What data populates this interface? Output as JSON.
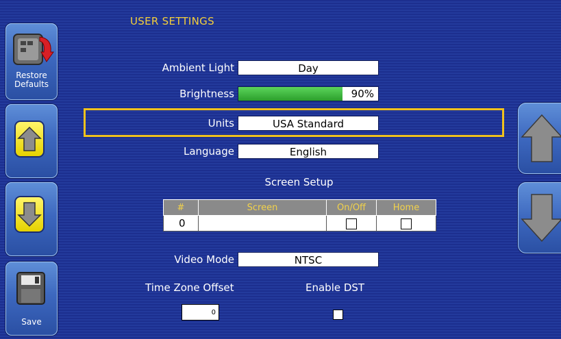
{
  "header": {
    "title": "USER SETTINGS"
  },
  "left_buttons": {
    "restore_label_line1": "Restore",
    "restore_label_line2": "Defaults",
    "save_label": "Save"
  },
  "settings": {
    "ambient_light": {
      "label": "Ambient Light",
      "value": "Day"
    },
    "brightness": {
      "label": "Brightness",
      "value": "90%",
      "level": 0.9
    },
    "units": {
      "label": "Units",
      "value": "USA Standard"
    },
    "language": {
      "label": "Language",
      "value": "English"
    }
  },
  "screen_setup": {
    "title": "Screen Setup",
    "columns": [
      "#",
      "Screen",
      "On/Off",
      "Home"
    ],
    "rows": [
      {
        "num": "0",
        "screen": "",
        "on_off": false,
        "home": false
      }
    ]
  },
  "video_mode": {
    "label": "Video Mode",
    "value": "NTSC"
  },
  "time_zone": {
    "label": "Time Zone Offset",
    "value": "0"
  },
  "dst": {
    "label": "Enable DST",
    "checked": false
  },
  "colors": {
    "title": "#f4cf3a",
    "highlight_frame": "#f0c21d",
    "brightness_fill": "#2c9f2c"
  }
}
